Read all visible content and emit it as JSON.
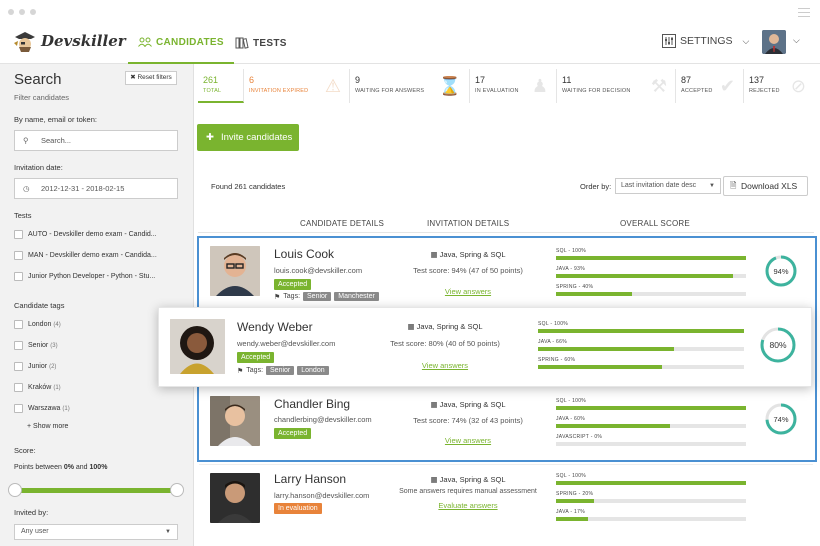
{
  "nav": {
    "logo": "Devskiller",
    "tab_candidates": "CANDIDATES",
    "tab_tests": "TESTS",
    "settings": "SETTINGS"
  },
  "sidebar": {
    "title": "Search",
    "subtitle": "Filter candidates",
    "reset": "Reset filters",
    "by_label": "By name, email or token:",
    "search_placeholder": "Search...",
    "date_label": "Invitation date:",
    "date_value": "2012-12-31 - 2018-02-15",
    "tests_label": "Tests",
    "tests": [
      "AUTO - Devskiller demo exam - Candid...",
      "MAN - Devskiller demo exam - Candida...",
      "Junior Python Developer - Python - Stu..."
    ],
    "tags_label": "Candidate tags",
    "tags": [
      {
        "name": "London",
        "count": "(4)"
      },
      {
        "name": "Senior",
        "count": "(3)"
      },
      {
        "name": "Junior",
        "count": "(2)"
      },
      {
        "name": "Kraków",
        "count": "(1)"
      },
      {
        "name": "Warszawa",
        "count": "(1)"
      }
    ],
    "show_more": "Show more",
    "score_label": "Score:",
    "points_pre": "Points between ",
    "points_min": "0%",
    "points_mid": " and ",
    "points_max": "100%",
    "invited_label": "Invited by:",
    "invited_value": "Any user"
  },
  "stats": [
    {
      "n": "261",
      "t": "TOTAL"
    },
    {
      "n": "6",
      "t": "INVITATION EXPIRED"
    },
    {
      "n": "9",
      "t": "WAITING FOR ANSWERS"
    },
    {
      "n": "17",
      "t": "IN EVALUATION"
    },
    {
      "n": "11",
      "t": "WAITING FOR DECISION"
    },
    {
      "n": "87",
      "t": "ACCEPTED"
    },
    {
      "n": "137",
      "t": "REJECTED"
    }
  ],
  "main": {
    "invite": "Invite candidates",
    "found": "Found 261 candidates",
    "order_by": "Order by:",
    "order_value": "Last invitation date desc",
    "download": "Download XLS",
    "col_details": "CANDIDATE DETAILS",
    "col_invitation": "INVITATION DETAILS",
    "col_score": "OVERALL SCORE"
  },
  "candidates": [
    {
      "name": "Louis Cook",
      "email": "louis.cook@devskiller.com",
      "status": "Accepted",
      "tags_label": "Tags:",
      "tags": [
        "Senior",
        "Manchester"
      ],
      "tech": "Java, Spring & SQL",
      "score_text": "Test score: 94% (47 of 50 points)",
      "link": "View answers",
      "bars": [
        {
          "label": "SQL - 100%",
          "pct": 100
        },
        {
          "label": "JAVA - 93%",
          "pct": 93
        },
        {
          "label": "SPRING - 40%",
          "pct": 40
        }
      ],
      "overall": "94%",
      "overall_pct": 94
    },
    {
      "name": "Chandler Bing",
      "email": "chandlerbing@devskiller.com",
      "status": "Accepted",
      "tech": "Java, Spring & SQL",
      "score_text": "Test score: 74% (32 of 43 points)",
      "link": "View answers",
      "bars": [
        {
          "label": "SQL - 100%",
          "pct": 100
        },
        {
          "label": "JAVA - 60%",
          "pct": 60
        },
        {
          "label": "JAVASCRIPT - 0%",
          "pct": 0
        }
      ],
      "overall": "74%",
      "overall_pct": 74
    },
    {
      "name": "Larry Hanson",
      "email": "larry.hanson@devskiller.com",
      "status": "In evaluation",
      "tech": "Java, Spring & SQL",
      "score_text": "Some answers requires manual assessment",
      "link": "Evaluate answers",
      "bars": [
        {
          "label": "SQL - 100%",
          "pct": 100
        },
        {
          "label": "SPRING - 20%",
          "pct": 20
        },
        {
          "label": "JAVA - 17%",
          "pct": 17
        }
      ]
    }
  ],
  "popup": {
    "name": "Wendy Weber",
    "email": "wendy.weber@devskiller.com",
    "status": "Accepted",
    "tags_label": "Tags:",
    "tags": [
      "Senior",
      "London"
    ],
    "tech": "Java, Spring & SQL",
    "score_text": "Test score: 80% (40 of 50 points)",
    "link": "View answers",
    "bars": [
      {
        "label": "SQL - 100%",
        "pct": 100
      },
      {
        "label": "JAVA - 66%",
        "pct": 66
      },
      {
        "label": "SPRING - 60%",
        "pct": 60
      }
    ],
    "overall": "80%",
    "overall_pct": 80
  },
  "colors": {
    "brand": "#7ab42f",
    "orange": "#e8833a",
    "ring": "#3db39e",
    "select": "#4a90d2"
  },
  "icons": [
    "users-icon",
    "book-icon",
    "sliders-icon",
    "chevron-down-icon",
    "calendar-icon",
    "user-plus-icon",
    "file-icon",
    "tag-icon",
    "hourglass-icon",
    "warning-icon",
    "thumbs-up-icon",
    "ban-icon"
  ]
}
